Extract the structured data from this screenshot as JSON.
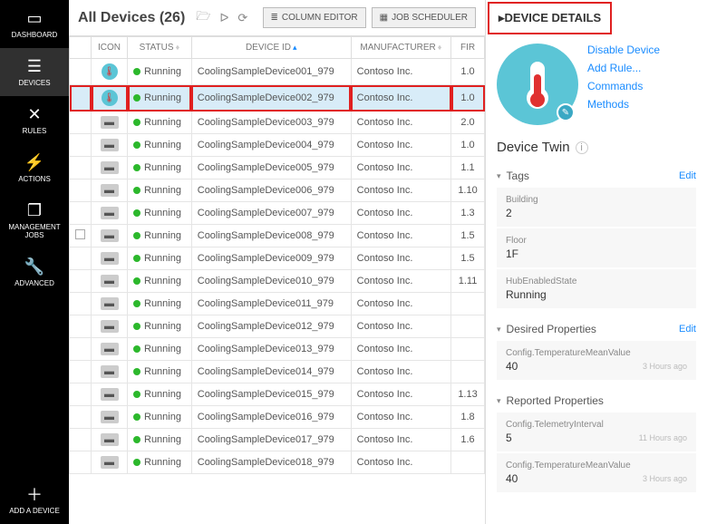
{
  "sidebar": {
    "items": [
      {
        "label": "DASHBOARD"
      },
      {
        "label": "DEVICES"
      },
      {
        "label": "RULES"
      },
      {
        "label": "ACTIONS"
      },
      {
        "label": "MANAGEMENT JOBS"
      },
      {
        "label": "ADVANCED"
      }
    ],
    "add": "ADD A DEVICE"
  },
  "topbar": {
    "title": "All Devices (26)",
    "column_editor": "COLUMN EDITOR",
    "job_scheduler": "JOB SCHEDULER"
  },
  "columns": {
    "icon": "ICON",
    "status": "STATUS",
    "device_id": "DEVICE ID",
    "manufacturer": "MANUFACTURER",
    "fir": "FIR"
  },
  "rows": [
    {
      "icon": "therm",
      "status": "Running",
      "id": "CoolingSampleDevice001_979",
      "mfr": "Contoso Inc.",
      "fir": "1.0",
      "sel": false
    },
    {
      "icon": "therm",
      "status": "Running",
      "id": "CoolingSampleDevice002_979",
      "mfr": "Contoso Inc.",
      "fir": "1.0",
      "sel": true
    },
    {
      "icon": "dev",
      "status": "Running",
      "id": "CoolingSampleDevice003_979",
      "mfr": "Contoso Inc.",
      "fir": "2.0",
      "sel": false
    },
    {
      "icon": "dev",
      "status": "Running",
      "id": "CoolingSampleDevice004_979",
      "mfr": "Contoso Inc.",
      "fir": "1.0",
      "sel": false
    },
    {
      "icon": "dev",
      "status": "Running",
      "id": "CoolingSampleDevice005_979",
      "mfr": "Contoso Inc.",
      "fir": "1.1",
      "sel": false
    },
    {
      "icon": "dev",
      "status": "Running",
      "id": "CoolingSampleDevice006_979",
      "mfr": "Contoso Inc.",
      "fir": "1.10",
      "sel": false
    },
    {
      "icon": "dev",
      "status": "Running",
      "id": "CoolingSampleDevice007_979",
      "mfr": "Contoso Inc.",
      "fir": "1.3",
      "sel": false
    },
    {
      "icon": "dev",
      "status": "Running",
      "id": "CoolingSampleDevice008_979",
      "mfr": "Contoso Inc.",
      "fir": "1.5",
      "sel": false,
      "ck": true
    },
    {
      "icon": "dev",
      "status": "Running",
      "id": "CoolingSampleDevice009_979",
      "mfr": "Contoso Inc.",
      "fir": "1.5",
      "sel": false
    },
    {
      "icon": "dev",
      "status": "Running",
      "id": "CoolingSampleDevice010_979",
      "mfr": "Contoso Inc.",
      "fir": "1.11",
      "sel": false
    },
    {
      "icon": "dev",
      "status": "Running",
      "id": "CoolingSampleDevice011_979",
      "mfr": "Contoso Inc.",
      "fir": "",
      "sel": false
    },
    {
      "icon": "dev",
      "status": "Running",
      "id": "CoolingSampleDevice012_979",
      "mfr": "Contoso Inc.",
      "fir": "",
      "sel": false
    },
    {
      "icon": "dev",
      "status": "Running",
      "id": "CoolingSampleDevice013_979",
      "mfr": "Contoso Inc.",
      "fir": "",
      "sel": false
    },
    {
      "icon": "dev",
      "status": "Running",
      "id": "CoolingSampleDevice014_979",
      "mfr": "Contoso Inc.",
      "fir": "",
      "sel": false
    },
    {
      "icon": "dev",
      "status": "Running",
      "id": "CoolingSampleDevice015_979",
      "mfr": "Contoso Inc.",
      "fir": "1.13",
      "sel": false
    },
    {
      "icon": "dev",
      "status": "Running",
      "id": "CoolingSampleDevice016_979",
      "mfr": "Contoso Inc.",
      "fir": "1.8",
      "sel": false
    },
    {
      "icon": "dev",
      "status": "Running",
      "id": "CoolingSampleDevice017_979",
      "mfr": "Contoso Inc.",
      "fir": "1.6",
      "sel": false
    },
    {
      "icon": "dev",
      "status": "Running",
      "id": "CoolingSampleDevice018_979",
      "mfr": "Contoso Inc.",
      "fir": "",
      "sel": false
    }
  ],
  "details": {
    "title": "DEVICE DETAILS",
    "links": {
      "disable": "Disable Device",
      "add_rule": "Add Rule...",
      "commands": "Commands",
      "methods": "Methods"
    },
    "twin_title": "Device Twin",
    "tags": {
      "title": "Tags",
      "edit": "Edit",
      "items": [
        {
          "k": "Building",
          "v": "2"
        },
        {
          "k": "Floor",
          "v": "1F"
        },
        {
          "k": "HubEnabledState",
          "v": "Running"
        }
      ]
    },
    "desired": {
      "title": "Desired Properties",
      "edit": "Edit",
      "items": [
        {
          "k": "Config.TemperatureMeanValue",
          "v": "40",
          "ts": "3 Hours ago"
        }
      ]
    },
    "reported": {
      "title": "Reported Properties",
      "items": [
        {
          "k": "Config.TelemetryInterval",
          "v": "5",
          "ts": "11 Hours ago"
        },
        {
          "k": "Config.TemperatureMeanValue",
          "v": "40",
          "ts": "3 Hours ago"
        }
      ]
    }
  }
}
